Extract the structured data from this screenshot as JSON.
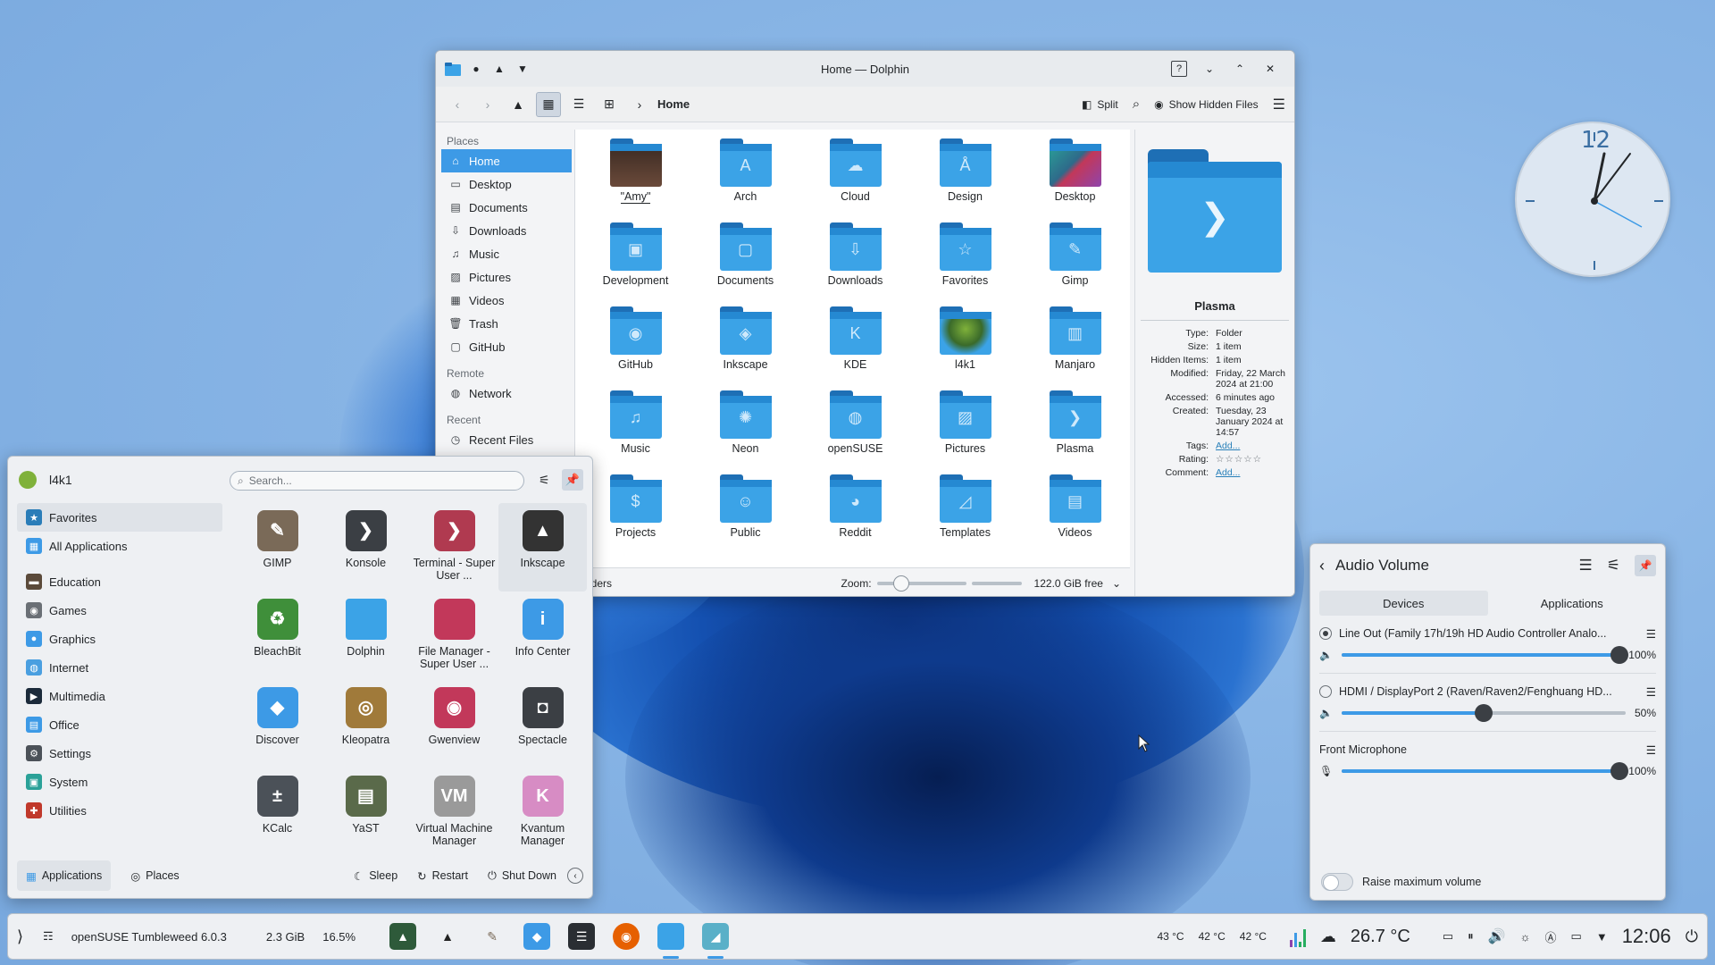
{
  "dolphin": {
    "title": "Home — Dolphin",
    "breadcrumb": "Home",
    "toolbar": {
      "split": "Split",
      "show_hidden": "Show Hidden Files"
    },
    "places": {
      "header": "Places",
      "items": [
        "Home",
        "Desktop",
        "Documents",
        "Downloads",
        "Music",
        "Pictures",
        "Videos",
        "Trash",
        "GitHub"
      ],
      "remote_header": "Remote",
      "remote_items": [
        "Network"
      ],
      "recent_header": "Recent",
      "recent_items": [
        "Recent Files"
      ]
    },
    "files": [
      {
        "name": "\"Amy\"",
        "glyph": ""
      },
      {
        "name": "Arch",
        "glyph": "A"
      },
      {
        "name": "Cloud",
        "glyph": "☁"
      },
      {
        "name": "Design",
        "glyph": "Å"
      },
      {
        "name": "Desktop",
        "glyph": ""
      },
      {
        "name": "Development",
        "glyph": "▣"
      },
      {
        "name": "Documents",
        "glyph": "▢"
      },
      {
        "name": "Downloads",
        "glyph": "⇩"
      },
      {
        "name": "Favorites",
        "glyph": "☆"
      },
      {
        "name": "Gimp",
        "glyph": "✎"
      },
      {
        "name": "GitHub",
        "glyph": "◉"
      },
      {
        "name": "Inkscape",
        "glyph": "◈"
      },
      {
        "name": "KDE",
        "glyph": "K"
      },
      {
        "name": "l4k1",
        "glyph": ""
      },
      {
        "name": "Manjaro",
        "glyph": "▥"
      },
      {
        "name": "Music",
        "glyph": "♫"
      },
      {
        "name": "Neon",
        "glyph": "✺"
      },
      {
        "name": "openSUSE",
        "glyph": "◍"
      },
      {
        "name": "Pictures",
        "glyph": "▨"
      },
      {
        "name": "Plasma",
        "glyph": "❯"
      },
      {
        "name": "Projects",
        "glyph": "$"
      },
      {
        "name": "Public",
        "glyph": "☺"
      },
      {
        "name": "Reddit",
        "glyph": "◕"
      },
      {
        "name": "Templates",
        "glyph": "◿"
      },
      {
        "name": "Videos",
        "glyph": "▤"
      }
    ],
    "status": {
      "count": "folders",
      "zoom_label": "Zoom:",
      "free": "122.0 GiB free"
    },
    "info": {
      "name": "Plasma",
      "props": [
        {
          "k": "Type:",
          "v": "Folder"
        },
        {
          "k": "Size:",
          "v": "1 item"
        },
        {
          "k": "Hidden Items:",
          "v": "1 item"
        },
        {
          "k": "Modified:",
          "v": "Friday, 22 March 2024 at 21:00"
        },
        {
          "k": "Accessed:",
          "v": "6 minutes ago"
        },
        {
          "k": "Created:",
          "v": "Tuesday, 23 January 2024 at 14:57"
        },
        {
          "k": "Tags:",
          "v": "Add..."
        },
        {
          "k": "Rating:",
          "v": "☆☆☆☆☆"
        },
        {
          "k": "Comment:",
          "v": "Add..."
        }
      ]
    }
  },
  "launcher": {
    "user": "l4k1",
    "search_placeholder": "Search...",
    "categories": [
      {
        "label": "Favorites",
        "color": "#2a7db8",
        "glyph": "★"
      },
      {
        "label": "All Applications",
        "color": "#3d9ae6",
        "glyph": "▦"
      },
      {
        "label": "Education",
        "color": "#5b4a3a",
        "glyph": "▬"
      },
      {
        "label": "Games",
        "color": "#6a6f75",
        "glyph": "◉"
      },
      {
        "label": "Graphics",
        "color": "#3d9ae6",
        "glyph": "●"
      },
      {
        "label": "Internet",
        "color": "#4a9fe0",
        "glyph": "◍"
      },
      {
        "label": "Multimedia",
        "color": "#1b2a3a",
        "glyph": "▶"
      },
      {
        "label": "Office",
        "color": "#3d9ae6",
        "glyph": "▤"
      },
      {
        "label": "Settings",
        "color": "#4b5158",
        "glyph": "⚙"
      },
      {
        "label": "System",
        "color": "#2aa198",
        "glyph": "▣"
      },
      {
        "label": "Utilities",
        "color": "#c0392b",
        "glyph": "✚"
      }
    ],
    "apps": [
      {
        "label": "GIMP",
        "color": "#7a6a58",
        "glyph": "✎"
      },
      {
        "label": "Konsole",
        "color": "#3b3f44",
        "glyph": "❯"
      },
      {
        "label": "Terminal - Super User ...",
        "color": "#b03a50",
        "glyph": "❯"
      },
      {
        "label": "Inkscape",
        "color": "#333333",
        "glyph": "▲"
      },
      {
        "label": "BleachBit",
        "color": "#3f8f3a",
        "glyph": "♻"
      },
      {
        "label": "Dolphin",
        "color": "#3ba3e7",
        "glyph": ""
      },
      {
        "label": "File Manager - Super User ...",
        "color": "#c2385a",
        "glyph": ""
      },
      {
        "label": "Info Center",
        "color": "#3d9ae6",
        "glyph": "i"
      },
      {
        "label": "Discover",
        "color": "#3d9ae6",
        "glyph": "◆"
      },
      {
        "label": "Kleopatra",
        "color": "#a07a3a",
        "glyph": "◎"
      },
      {
        "label": "Gwenview",
        "color": "#c2385a",
        "glyph": "◉"
      },
      {
        "label": "Spectacle",
        "color": "#3b3f44",
        "glyph": "◘"
      },
      {
        "label": "KCalc",
        "color": "#4b5158",
        "glyph": "±"
      },
      {
        "label": "YaST",
        "color": "#5a6a4a",
        "glyph": "▤"
      },
      {
        "label": "Virtual Machine Manager",
        "color": "#9a9a9a",
        "glyph": "VM"
      },
      {
        "label": "Kvantum Manager",
        "color": "#d78cc4",
        "glyph": "K"
      }
    ],
    "footer": {
      "applications": "Applications",
      "places": "Places",
      "sleep": "Sleep",
      "restart": "Restart",
      "shutdown": "Shut Down"
    }
  },
  "audio": {
    "title": "Audio Volume",
    "tabs": [
      "Devices",
      "Applications"
    ],
    "devices": [
      {
        "name": "Line Out (Family 17h/19h HD Audio Controller Analo...",
        "value": "100%",
        "level": 1.0,
        "selected": true
      },
      {
        "name": "HDMI / DisplayPort 2 (Raven/Raven2/Fenghuang HD...",
        "value": "50%",
        "level": 0.5,
        "selected": false
      }
    ],
    "mic": {
      "name": "Front Microphone",
      "value": "100%",
      "level": 1.0
    },
    "raise_max": "Raise maximum volume"
  },
  "taskbar": {
    "os_label": "openSUSE Tumbleweed 6.0.3",
    "mem": "2.3 GiB",
    "cpu": "16.5%",
    "temps": [
      "43 °C",
      "42 °C",
      "42 °C"
    ],
    "weather": "26.7 °C",
    "time": "12:06"
  },
  "clock": {
    "numeral": "12"
  }
}
